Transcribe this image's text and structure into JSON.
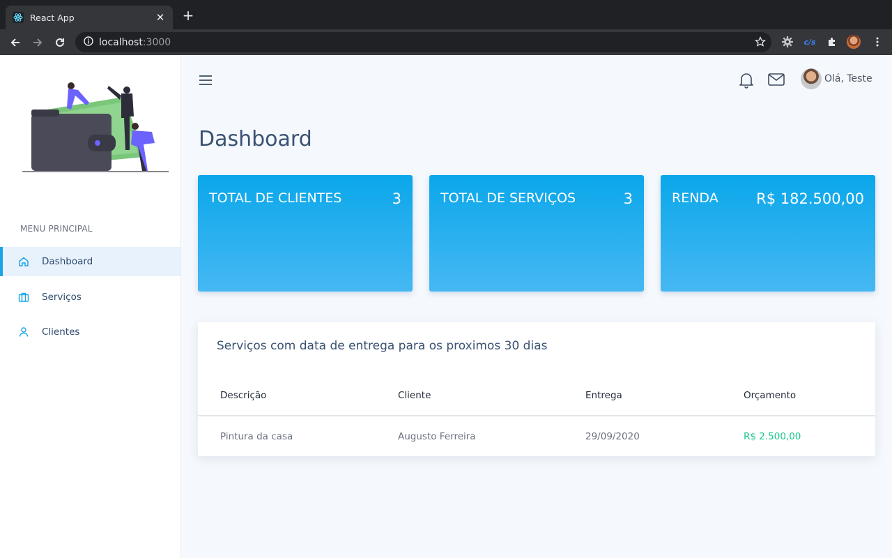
{
  "browser": {
    "tab_title": "React App",
    "url_host": "localhost",
    "url_port": ":3000",
    "ext_label": "c/s"
  },
  "sidebar": {
    "menu_title": "MENU PRINCIPAL",
    "items": [
      {
        "label": "Dashboard",
        "icon": "home-icon",
        "active": true
      },
      {
        "label": "Serviços",
        "icon": "briefcase-icon",
        "active": false
      },
      {
        "label": "Clientes",
        "icon": "user-icon",
        "active": false
      }
    ]
  },
  "header": {
    "greeting": "Olá, Teste"
  },
  "page": {
    "title": "Dashboard"
  },
  "cards": [
    {
      "title": "TOTAL DE CLIENTES",
      "value": "3"
    },
    {
      "title": "TOTAL DE SERVIÇOS",
      "value": "3"
    },
    {
      "title": "RENDA",
      "value": "R$ 182.500,00"
    }
  ],
  "table": {
    "title": "Serviços com data de entrega para os proximos 30 dias",
    "columns": [
      "Descrição",
      "Cliente",
      "Entrega",
      "Orçamento"
    ],
    "rows": [
      [
        "Pintura da casa",
        "Augusto Ferreira",
        "29/09/2020",
        "R$ 2.500,00"
      ]
    ]
  },
  "colors": {
    "accent": "#1ba4e8",
    "card_gradient_top": "#0aa7ea",
    "card_gradient_bottom": "#46b8f3",
    "money": "#18c98a",
    "heading": "#3a5273"
  }
}
